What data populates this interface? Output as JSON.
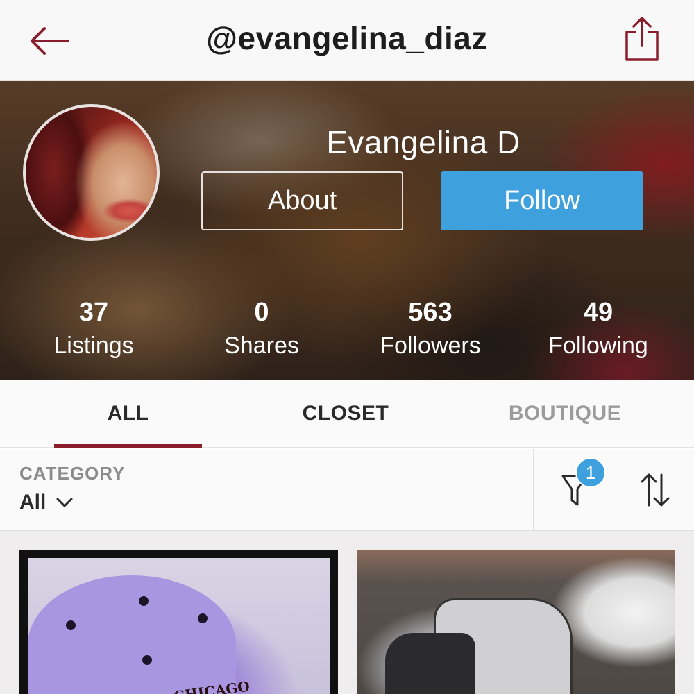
{
  "header": {
    "handle": "@evangelina_diaz",
    "back_icon": "back-arrow-icon",
    "share_icon": "share-icon"
  },
  "profile": {
    "display_name": "Evangelina D",
    "about_label": "About",
    "follow_label": "Follow",
    "stats": [
      {
        "value": "37",
        "label": "Listings"
      },
      {
        "value": "0",
        "label": "Shares"
      },
      {
        "value": "563",
        "label": "Followers"
      },
      {
        "value": "49",
        "label": "Following"
      }
    ]
  },
  "tabs": [
    {
      "label": "ALL",
      "active": true
    },
    {
      "label": "CLOSET",
      "active": false
    },
    {
      "label": "BOUTIQUE",
      "active": false
    }
  ],
  "filter": {
    "category_label": "CATEGORY",
    "category_value": "All",
    "filter_badge": "1",
    "filter_icon": "filter-funnel-icon",
    "sort_icon": "sort-arrows-icon"
  },
  "listings": [
    {
      "image": "lavender-chicago-cap",
      "caption_text": "CHICAGO"
    },
    {
      "image": "grey-sneakers"
    }
  ],
  "colors": {
    "accent_red": "#8a1d2c",
    "follow_blue": "#3ea0dc",
    "inactive_tab": "#9b9b9b"
  }
}
